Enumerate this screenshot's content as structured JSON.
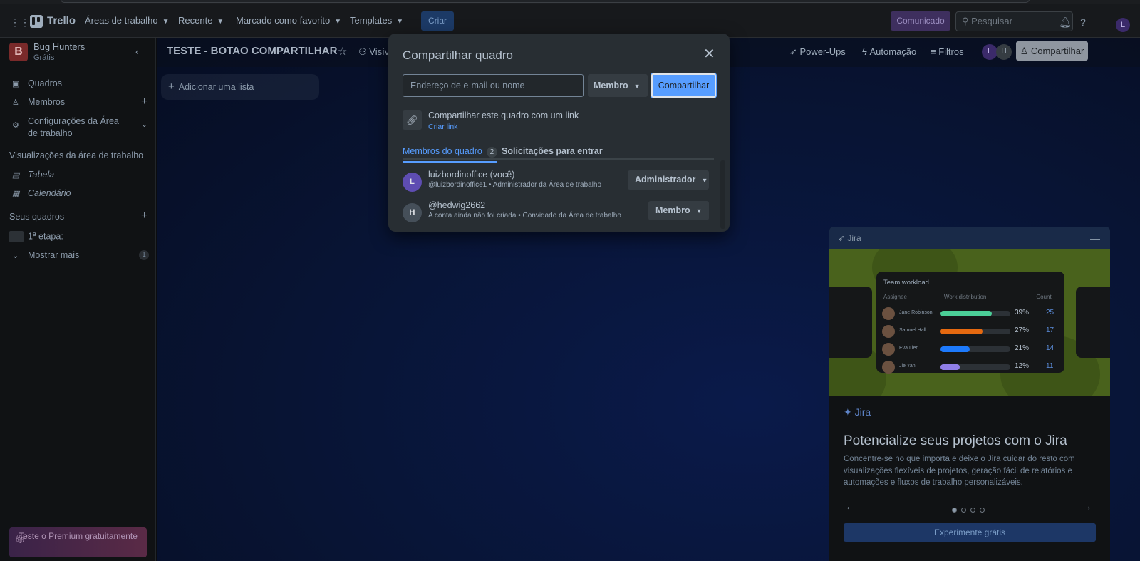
{
  "topbar": {
    "app_name": "Trello",
    "nav": [
      {
        "label": "Áreas de trabalho"
      },
      {
        "label": "Recente"
      },
      {
        "label": "Marcado como favorito"
      },
      {
        "label": "Templates"
      }
    ],
    "create_label": "Criar",
    "announcement_label": "Comunicado",
    "search_placeholder": "Pesquisar",
    "user_initial": "L"
  },
  "sidebar": {
    "workspace_initial": "B",
    "workspace_name": "Bug Hunters",
    "workspace_plan": "Grátis",
    "items": [
      {
        "label": "Quadros"
      },
      {
        "label": "Membros"
      },
      {
        "label": "Configurações da Área de trabalho"
      }
    ],
    "views_heading": "Visualizações da área de trabalho",
    "views": [
      {
        "label": "Tabela"
      },
      {
        "label": "Calendário"
      }
    ],
    "boards_heading": "Seus quadros",
    "boards": [
      {
        "label": "1ª etapa:"
      }
    ],
    "show_more_label": "Mostrar mais",
    "show_more_count": "1",
    "premium_label": "Teste o Premium gratuitamente"
  },
  "board": {
    "title": "TESTE - BOTAO COMPARTILHAR",
    "visibility_label": "Visív",
    "powerups_label": "Power-Ups",
    "automation_label": "Automação",
    "filters_label": "Filtros",
    "avatars": [
      "L",
      "H"
    ],
    "share_label": "Compartilhar",
    "add_list_label": "Adicionar uma lista"
  },
  "modal": {
    "title": "Compartilhar quadro",
    "input_placeholder": "Endereço de e-mail ou nome",
    "role_label": "Membro",
    "share_button": "Compartilhar",
    "link_text": "Compartilhar este quadro com um link",
    "link_action": "Criar link",
    "tabs": [
      {
        "label": "Membros do quadro",
        "count": "2"
      },
      {
        "label": "Solicitações para entrar"
      }
    ],
    "members": [
      {
        "initial": "L",
        "name": "luizbordinoffice (você)",
        "subtitle": "@luizbordinoffice1 • Administrador da Área de trabalho",
        "role": "Administrador",
        "color": "#5e4db2"
      },
      {
        "initial": "H",
        "name": "@hedwig2662",
        "subtitle": "A conta ainda não foi criada • Convidado da Área de trabalho",
        "role": "Membro",
        "color": "#454f59"
      }
    ]
  },
  "jira_panel": {
    "bar_title": "Jira",
    "card_title": "Team workload",
    "col_assignee": "Assignee",
    "col_work": "Work distribution",
    "col_count": "Count",
    "rows": [
      {
        "name": "Jane Robinson",
        "percent": "39%",
        "count": "25",
        "fill": 0.73,
        "color": "#4bce97"
      },
      {
        "name": "Samuel Hall",
        "percent": "27%",
        "count": "17",
        "fill": 0.6,
        "color": "#e56910"
      },
      {
        "name": "Eva Lien",
        "percent": "21%",
        "count": "14",
        "fill": 0.42,
        "color": "#1d7afc"
      },
      {
        "name": "Jie Yan",
        "percent": "12%",
        "count": "11",
        "fill": 0.28,
        "color": "#8f7ee7"
      }
    ],
    "logo_label": "Jira",
    "heading": "Potencialize seus projetos com o Jira",
    "body": "Concentre-se no que importa e deixe o Jira cuidar do resto com visualizações flexíveis de projetos, geração fácil de relatórios e automações e fluxos de trabalho personalizáveis.",
    "cta": "Experimente grátis"
  }
}
